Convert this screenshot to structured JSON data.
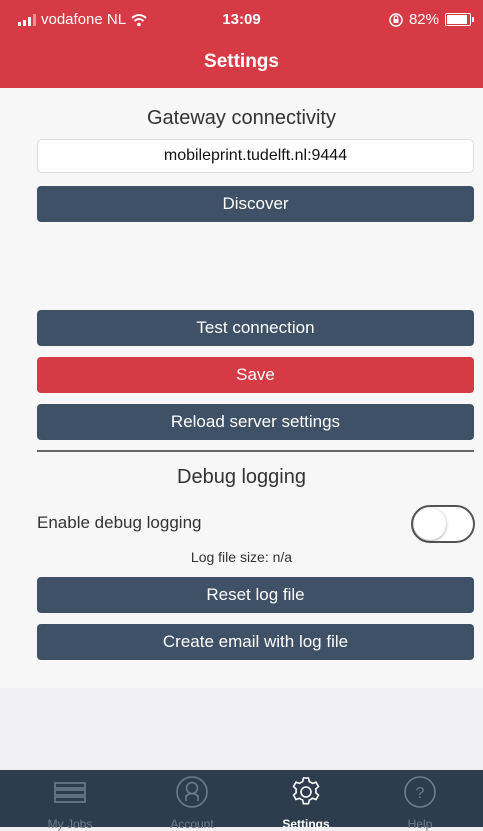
{
  "status_bar": {
    "carrier": "vodafone NL",
    "time": "13:09",
    "battery": "82%",
    "battery_level": 0.82
  },
  "header": {
    "title": "Settings"
  },
  "gateway": {
    "title": "Gateway connectivity",
    "url_value": "mobileprint.tudelft.nl:9444",
    "discover_label": "Discover",
    "test_label": "Test connection",
    "save_label": "Save",
    "reload_label": "Reload server settings"
  },
  "debug": {
    "title": "Debug logging",
    "enable_label": "Enable debug logging",
    "enabled": false,
    "log_size_label": "Log file size:",
    "log_size_value": "n/a",
    "reset_label": "Reset log file",
    "email_label": "Create email with log file"
  },
  "colors": {
    "accent_red": "#d63a45",
    "button_slate": "#3e5166",
    "tabbar": "#2e3d4e"
  },
  "tabbar": {
    "tabs": [
      {
        "label": "My Jobs",
        "icon": "list-icon",
        "active": false
      },
      {
        "label": "Account",
        "icon": "user-icon",
        "active": false
      },
      {
        "label": "Settings",
        "icon": "gear-icon",
        "active": true
      },
      {
        "label": "Help",
        "icon": "help-icon",
        "active": false
      }
    ]
  }
}
